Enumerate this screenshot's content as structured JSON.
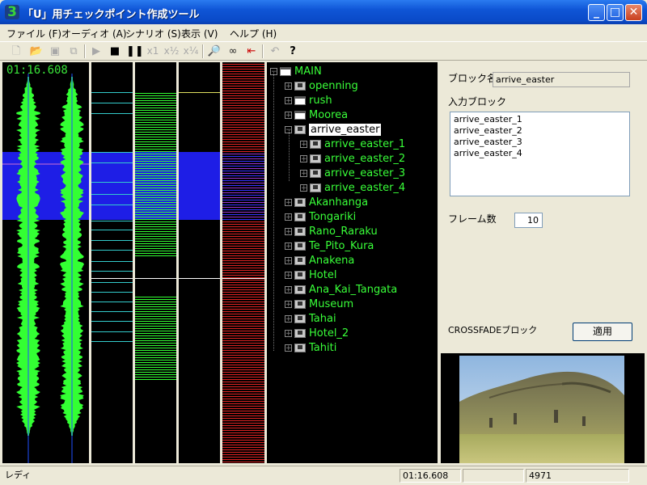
{
  "window": {
    "title": "「U」用チェックポイント作成ツール",
    "app_icon": "3"
  },
  "menu": [
    "ファイル (F)",
    "オーディオ (A)",
    "シナリオ (S)",
    "表示 (V)",
    "ヘルプ (H)"
  ],
  "toolbar": {
    "icons": [
      "new-file-icon",
      "open-folder-icon",
      "save-icon",
      "save-all-icon",
      "play-icon",
      "stop-icon",
      "pause-icon",
      "speed-x1-icon",
      "speed-half-icon",
      "speed-quarter-icon",
      "search-icon",
      "binoculars-icon",
      "marker-icon",
      "undo-icon",
      "help-icon"
    ],
    "speed_x1": "x1",
    "speed_half": "x½",
    "speed_quarter": "x¼"
  },
  "wave": {
    "time": "01:16.608"
  },
  "tree": {
    "root": "MAIN",
    "items": [
      {
        "label": "openning",
        "icon": "disk"
      },
      {
        "label": "rush",
        "icon": "window"
      },
      {
        "label": "Moorea",
        "icon": "window"
      },
      {
        "label": "arrive_easter",
        "icon": "disk",
        "selected": true,
        "expanded": true,
        "children": [
          "arrive_easter_1",
          "arrive_easter_2",
          "arrive_easter_3",
          "arrive_easter_4"
        ]
      },
      {
        "label": "Akanhanga",
        "icon": "disk"
      },
      {
        "label": "Tongariki",
        "icon": "disk"
      },
      {
        "label": "Rano_Raraku",
        "icon": "disk"
      },
      {
        "label": "Te_Pito_Kura",
        "icon": "disk"
      },
      {
        "label": "Anakena",
        "icon": "disk"
      },
      {
        "label": "Hotel",
        "icon": "disk"
      },
      {
        "label": "Ana_Kai_Tangata",
        "icon": "disk"
      },
      {
        "label": "Museum",
        "icon": "disk"
      },
      {
        "label": "Tahai",
        "icon": "disk"
      },
      {
        "label": "Hotel_2",
        "icon": "disk"
      },
      {
        "label": "Tahiti",
        "icon": "disk"
      }
    ]
  },
  "props": {
    "block_name_label": "ブロック名",
    "block_name_value": "arrive_easter",
    "input_blocks_label": "入力ブロック",
    "input_blocks": [
      "arrive_easter_1",
      "arrive_easter_2",
      "arrive_easter_3",
      "arrive_easter_4"
    ],
    "frames_label": "フレーム数",
    "frames_value": "10",
    "crossfade_label": "CROSSFADEブロック",
    "apply_button": "適用"
  },
  "status": {
    "text": "レディ",
    "time": "01:16.608",
    "cell2": "",
    "count": "4971"
  },
  "colors": {
    "wave_green": "#33ff33",
    "selection_blue": "#1e1ee6",
    "marker_red": "#e02020",
    "accent_cyan": "#33cccc"
  }
}
